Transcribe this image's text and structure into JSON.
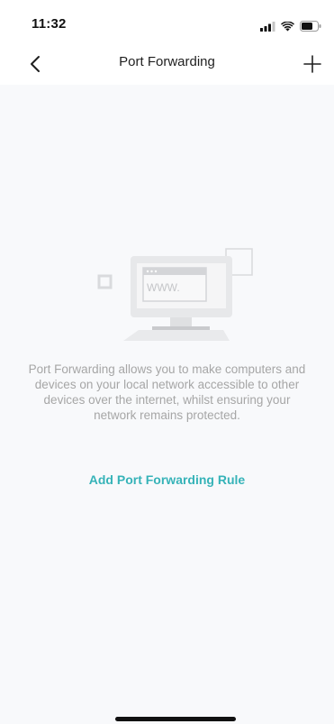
{
  "status_bar": {
    "time": "11:32",
    "icons": [
      "signal-icon",
      "wifi-icon",
      "battery-icon"
    ]
  },
  "nav": {
    "title": "Port Forwarding",
    "back_icon": "chevron-left-icon",
    "add_icon": "plus-icon"
  },
  "empty_state": {
    "illustration_icon": "computer-www-icon",
    "illustration_text": "WWW.",
    "description": "Port Forwarding allows you to make computers and devices on your local network accessible to other devices over the internet, whilst ensuring your network remains protected.",
    "action_label": "Add Port Forwarding Rule"
  },
  "colors": {
    "accent": "#36b3b8",
    "background": "#f8f9fb",
    "text_muted": "#a6a6a6"
  }
}
